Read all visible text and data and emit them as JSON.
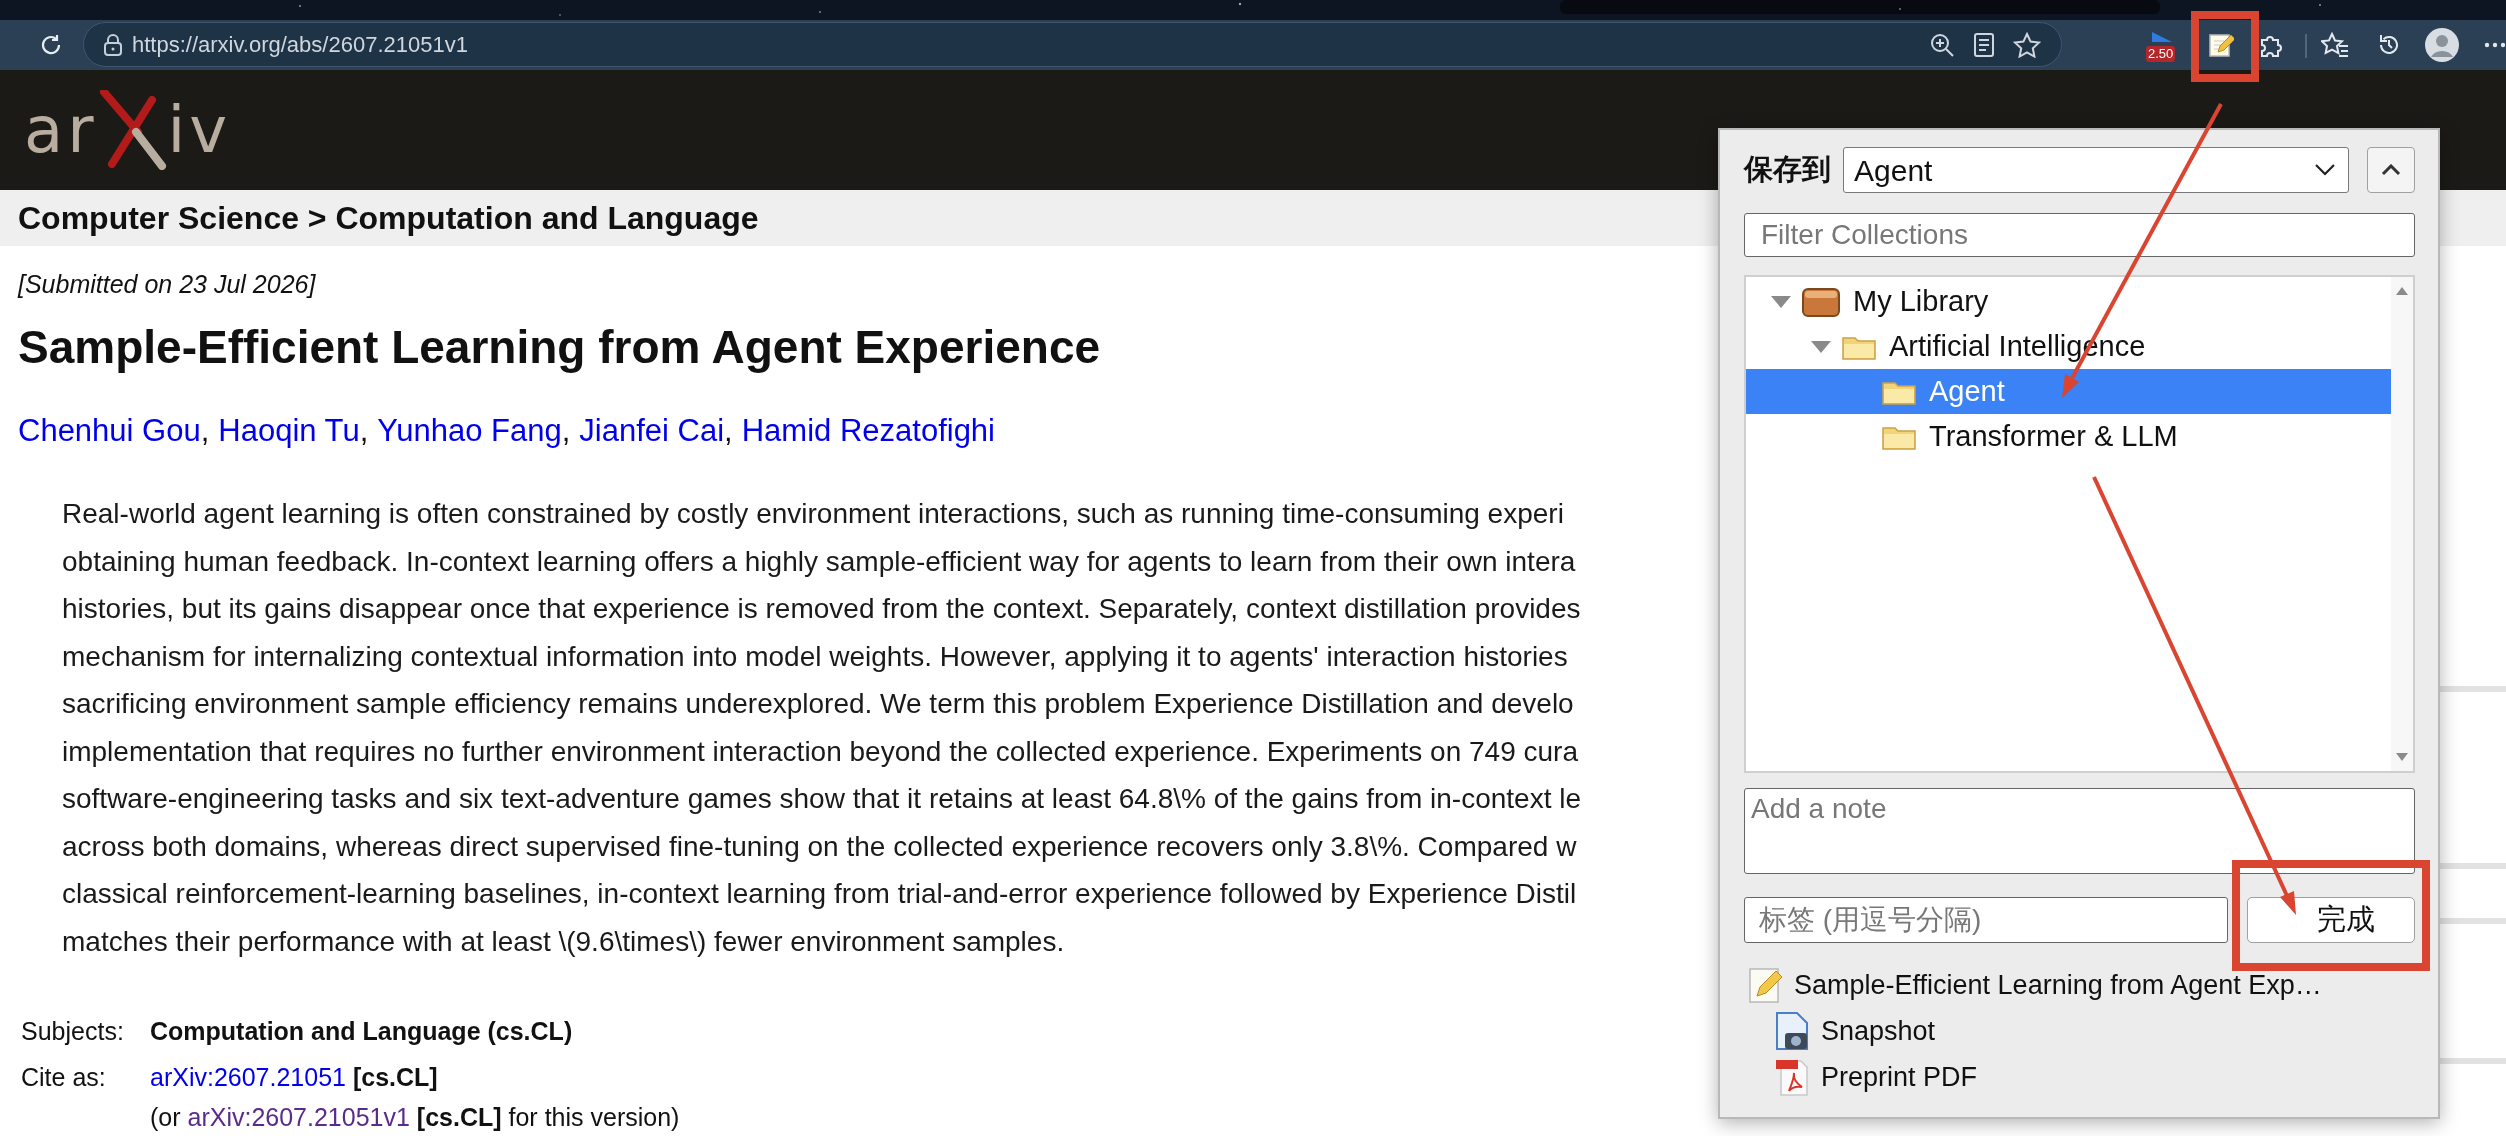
{
  "browser": {
    "url": "https://arxiv.org/abs/2607.21051v1",
    "extension_badge": "2.50"
  },
  "header": {
    "logo_before": "ar",
    "logo_after": "iv"
  },
  "breadcrumb": "Computer Science > Computation and Language",
  "submitted": "[Submitted on 23 Jul 2026]",
  "title": "Sample-Efficient Learning from Agent Experience",
  "authors": [
    "Chenhui Gou",
    "Haoqin Tu",
    "Yunhao Fang",
    "Jianfei Cai",
    "Hamid Rezatofighi"
  ],
  "author_separator": ",",
  "abstract_lines": [
    "Real-world agent learning is often constrained by costly environment interactions, such as running time-consuming experi",
    "obtaining human feedback. In-context learning offers a highly sample-efficient way for agents to learn from their own intera",
    "histories, but its gains disappear once that experience is removed from the context. Separately, context distillation provides",
    "mechanism for internalizing contextual information into model weights. However, applying it to agents' interaction histories",
    "sacrificing environment sample efficiency remains underexplored. We term this problem Experience Distillation and develo",
    "implementation that requires no further environment interaction beyond the collected experience. Experiments on 749 cura",
    "software-engineering tasks and six text-adventure games show that it retains at least 64.8\\% of the gains from in-context le",
    "across both domains, whereas direct supervised fine-tuning on the collected experience recovers only 3.8\\%. Compared w",
    "classical reinforcement-learning baselines, in-context learning from trial-and-error experience followed by Experience Distil",
    "matches their performance with at least \\(9.6\\times\\) fewer environment samples."
  ],
  "metadata": {
    "subjects_label": "Subjects:",
    "subjects": "Computation and Language (cs.CL)",
    "cite_label": "Cite as:",
    "cite_link": "arXiv:2607.21051",
    "cite_tag": "**[cs.CL]**",
    "version_prefix": "(or ",
    "version_link": "arXiv:2607.21051v1",
    "version_rest": "**[cs.CL]** for this version)"
  },
  "popup": {
    "save_label": "保存到",
    "target": "Agent",
    "filter_placeholder": "Filter Collections",
    "collections": [
      {
        "label": "My Library",
        "kind": "library",
        "expanded": true,
        "selected": false,
        "children": [
          {
            "label": "Artificial Intelligence",
            "kind": "folder",
            "expanded": true,
            "selected": false,
            "children": [
              {
                "label": "Agent",
                "kind": "folder",
                "selected": true
              },
              {
                "label": "Transformer & LLM",
                "kind": "folder",
                "selected": false
              }
            ]
          }
        ]
      }
    ],
    "note_placeholder": "Add a note",
    "tags_placeholder": "标签 (用逗号分隔)",
    "done_button": "完成",
    "items": [
      {
        "label": "Sample-Efficient Learning from Agent Exp…",
        "kind": "document",
        "children": [
          {
            "label": "Snapshot",
            "kind": "snapshot"
          },
          {
            "label": "Preprint PDF",
            "kind": "pdf"
          }
        ]
      }
    ]
  }
}
